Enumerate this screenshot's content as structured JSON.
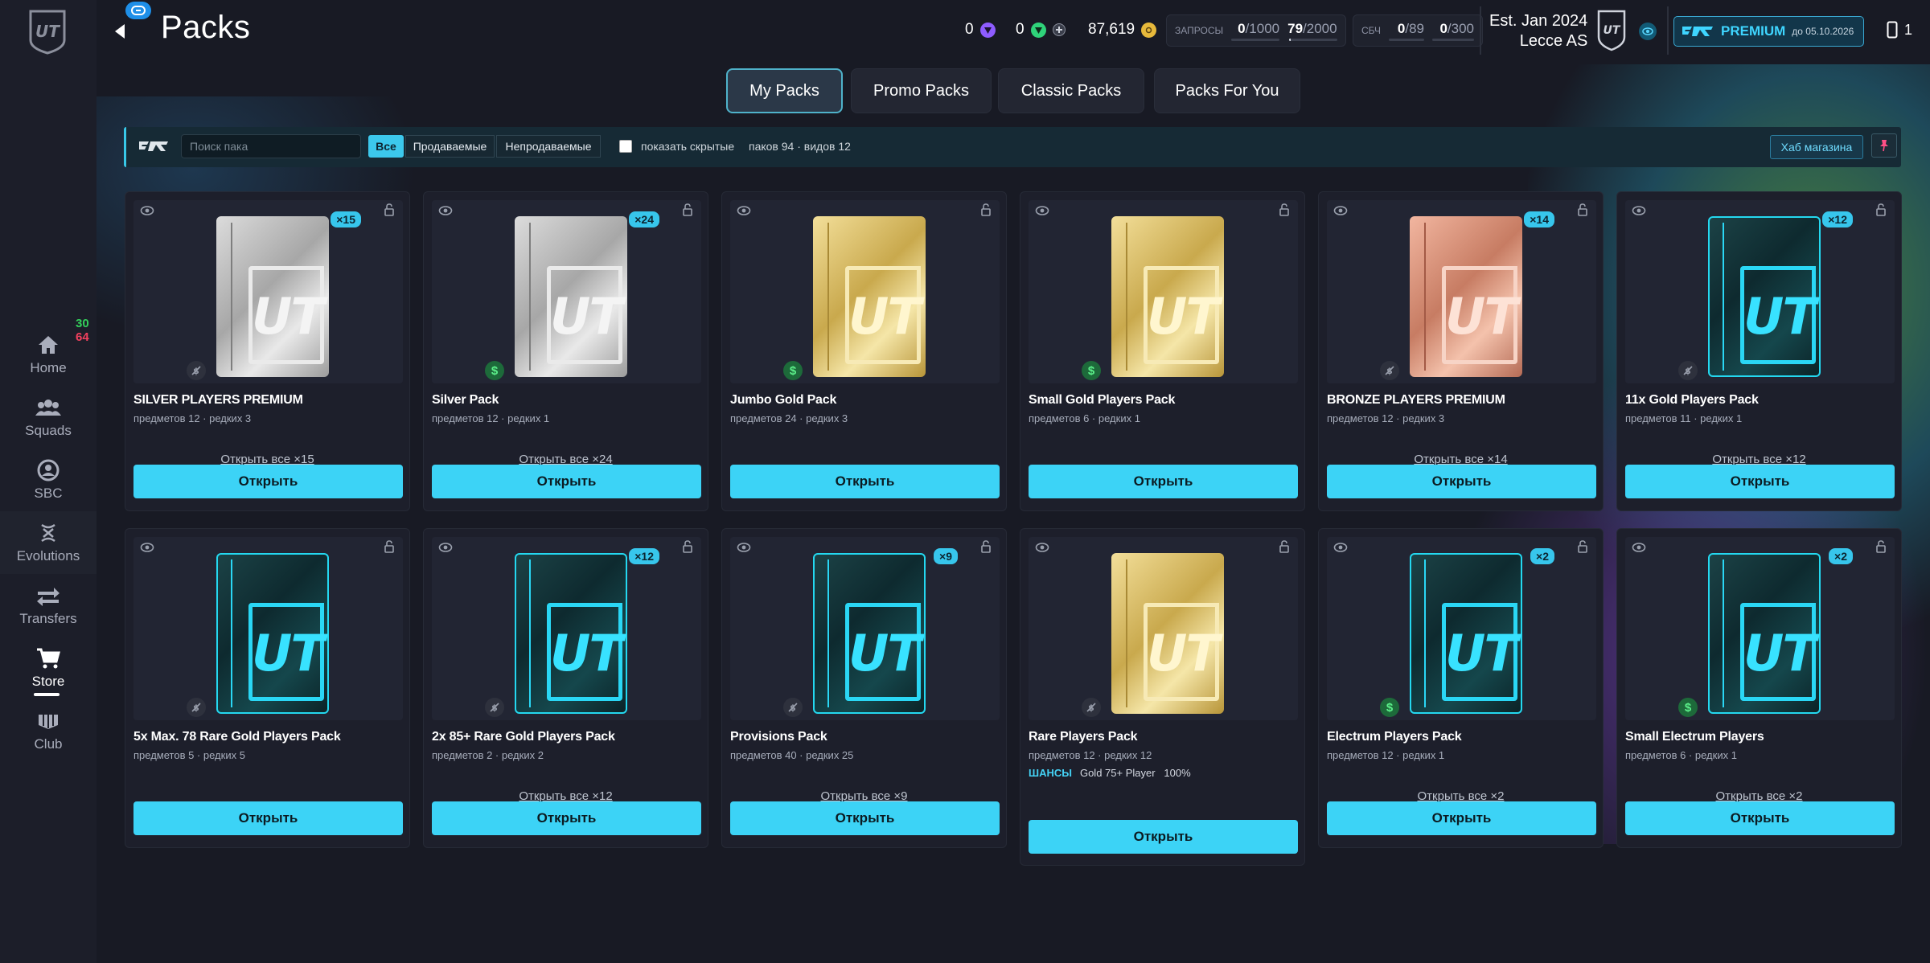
{
  "sidebar": {
    "items": [
      {
        "label": "Home",
        "icon": "home-icon"
      },
      {
        "label": "Squads",
        "icon": "squads-icon"
      },
      {
        "label": "SBC",
        "icon": "sbc-icon"
      },
      {
        "label": "Evolutions",
        "icon": "evolutions-icon"
      },
      {
        "label": "Transfers",
        "icon": "transfers-icon"
      },
      {
        "label": "Store",
        "icon": "cart-icon",
        "active": true
      },
      {
        "label": "Club",
        "icon": "club-icon"
      }
    ],
    "store_counts": {
      "green": "30",
      "red": "64"
    }
  },
  "header": {
    "title": "Packs",
    "currency": [
      {
        "value": "0",
        "icon": "points-icon",
        "color": "#8e5cff"
      },
      {
        "value": "0",
        "icon": "fc-points-icon",
        "color": "#2fd37a"
      },
      {
        "value": "87,619",
        "icon": "coins-icon",
        "color": "#e7b93b"
      }
    ],
    "requests": {
      "label": "ЗАПРОСЫ",
      "a_cur": "0",
      "a_max": "/1000",
      "a_fill": 0.0,
      "b_cur": "79",
      "b_max": "/2000",
      "b_fill": 0.04
    },
    "sbc": {
      "label": "СБЧ",
      "a_cur": "0",
      "a_max": "/89",
      "a_fill": 0.0,
      "b_cur": "0",
      "b_max": "/300",
      "b_fill": 0.0
    },
    "club": {
      "est": "Est. Jan 2024",
      "name": "Lecce AS"
    },
    "premium": {
      "label": "PREMIUM",
      "date": "до 05.10.2026"
    },
    "phone_count": "1"
  },
  "tabs": [
    {
      "label": "My Packs",
      "active": true
    },
    {
      "label": "Promo Packs"
    },
    {
      "label": "Classic Packs"
    },
    {
      "label": "Packs For You"
    }
  ],
  "toolbar": {
    "search_placeholder": "Поиск пака",
    "filters": [
      "Все",
      "Продаваемые",
      "Непродаваемые"
    ],
    "show_hidden_label": "показать скрытые",
    "counts": "паков 94 · видов 12",
    "hub_label": "Хаб магазина"
  },
  "open_label": "Открыть",
  "packs": [
    {
      "name": "SILVER PLAYERS PREMIUM",
      "meta": "предметов 12 · редких 3",
      "count": "×15",
      "open_all": "Открыть все ×15",
      "style": "silver",
      "tradable": false
    },
    {
      "name": "Silver Pack",
      "meta": "предметов 12 · редких 1",
      "count": "×24",
      "open_all": "Открыть все ×24",
      "style": "silver",
      "tradable": true
    },
    {
      "name": "Jumbo Gold Pack",
      "meta": "предметов 24 · редких 3",
      "count": "",
      "open_all": "",
      "style": "gold",
      "tradable": true
    },
    {
      "name": "Small Gold Players Pack",
      "meta": "предметов 6 · редких 1",
      "count": "",
      "open_all": "",
      "style": "gold",
      "tradable": true
    },
    {
      "name": "BRONZE PLAYERS PREMIUM",
      "meta": "предметов 12 · редких 3",
      "count": "×14",
      "open_all": "Открыть все ×14",
      "style": "bronze",
      "tradable": false
    },
    {
      "name": "11x Gold Players Pack",
      "meta": "предметов 11 · редких 1",
      "count": "×12",
      "open_all": "Открыть все ×12",
      "style": "teal",
      "tradable": false
    },
    {
      "name": "5x Max. 78 Rare Gold Players Pack",
      "meta": "предметов 5 · редких 5",
      "count": "",
      "open_all": "",
      "style": "teal",
      "tradable": false
    },
    {
      "name": "2x 85+ Rare Gold Players Pack",
      "meta": "предметов 2 · редких 2",
      "count": "×12",
      "open_all": "Открыть все ×12",
      "style": "teal",
      "tradable": false
    },
    {
      "name": "Provisions Pack",
      "meta": "предметов 40 · редких 25",
      "count": "×9",
      "open_all": "Открыть все ×9",
      "style": "teal",
      "tradable": false
    },
    {
      "name": "Rare Players Pack",
      "meta": "предметов 12 · редких 12",
      "count": "",
      "open_all": "",
      "style": "gold",
      "tradable": false,
      "odds": {
        "label": "ШАНСЫ",
        "text": "Gold 75+ Player",
        "value": "100%"
      }
    },
    {
      "name": "Electrum Players Pack",
      "meta": "предметов 12 · редких 1",
      "count": "×2",
      "open_all": "Открыть все ×2",
      "style": "teal",
      "tradable": true
    },
    {
      "name": "Small Electrum Players",
      "meta": "предметов 6 · редких 1",
      "count": "×2",
      "open_all": "Открыть все ×2",
      "style": "teal",
      "tradable": true
    }
  ]
}
